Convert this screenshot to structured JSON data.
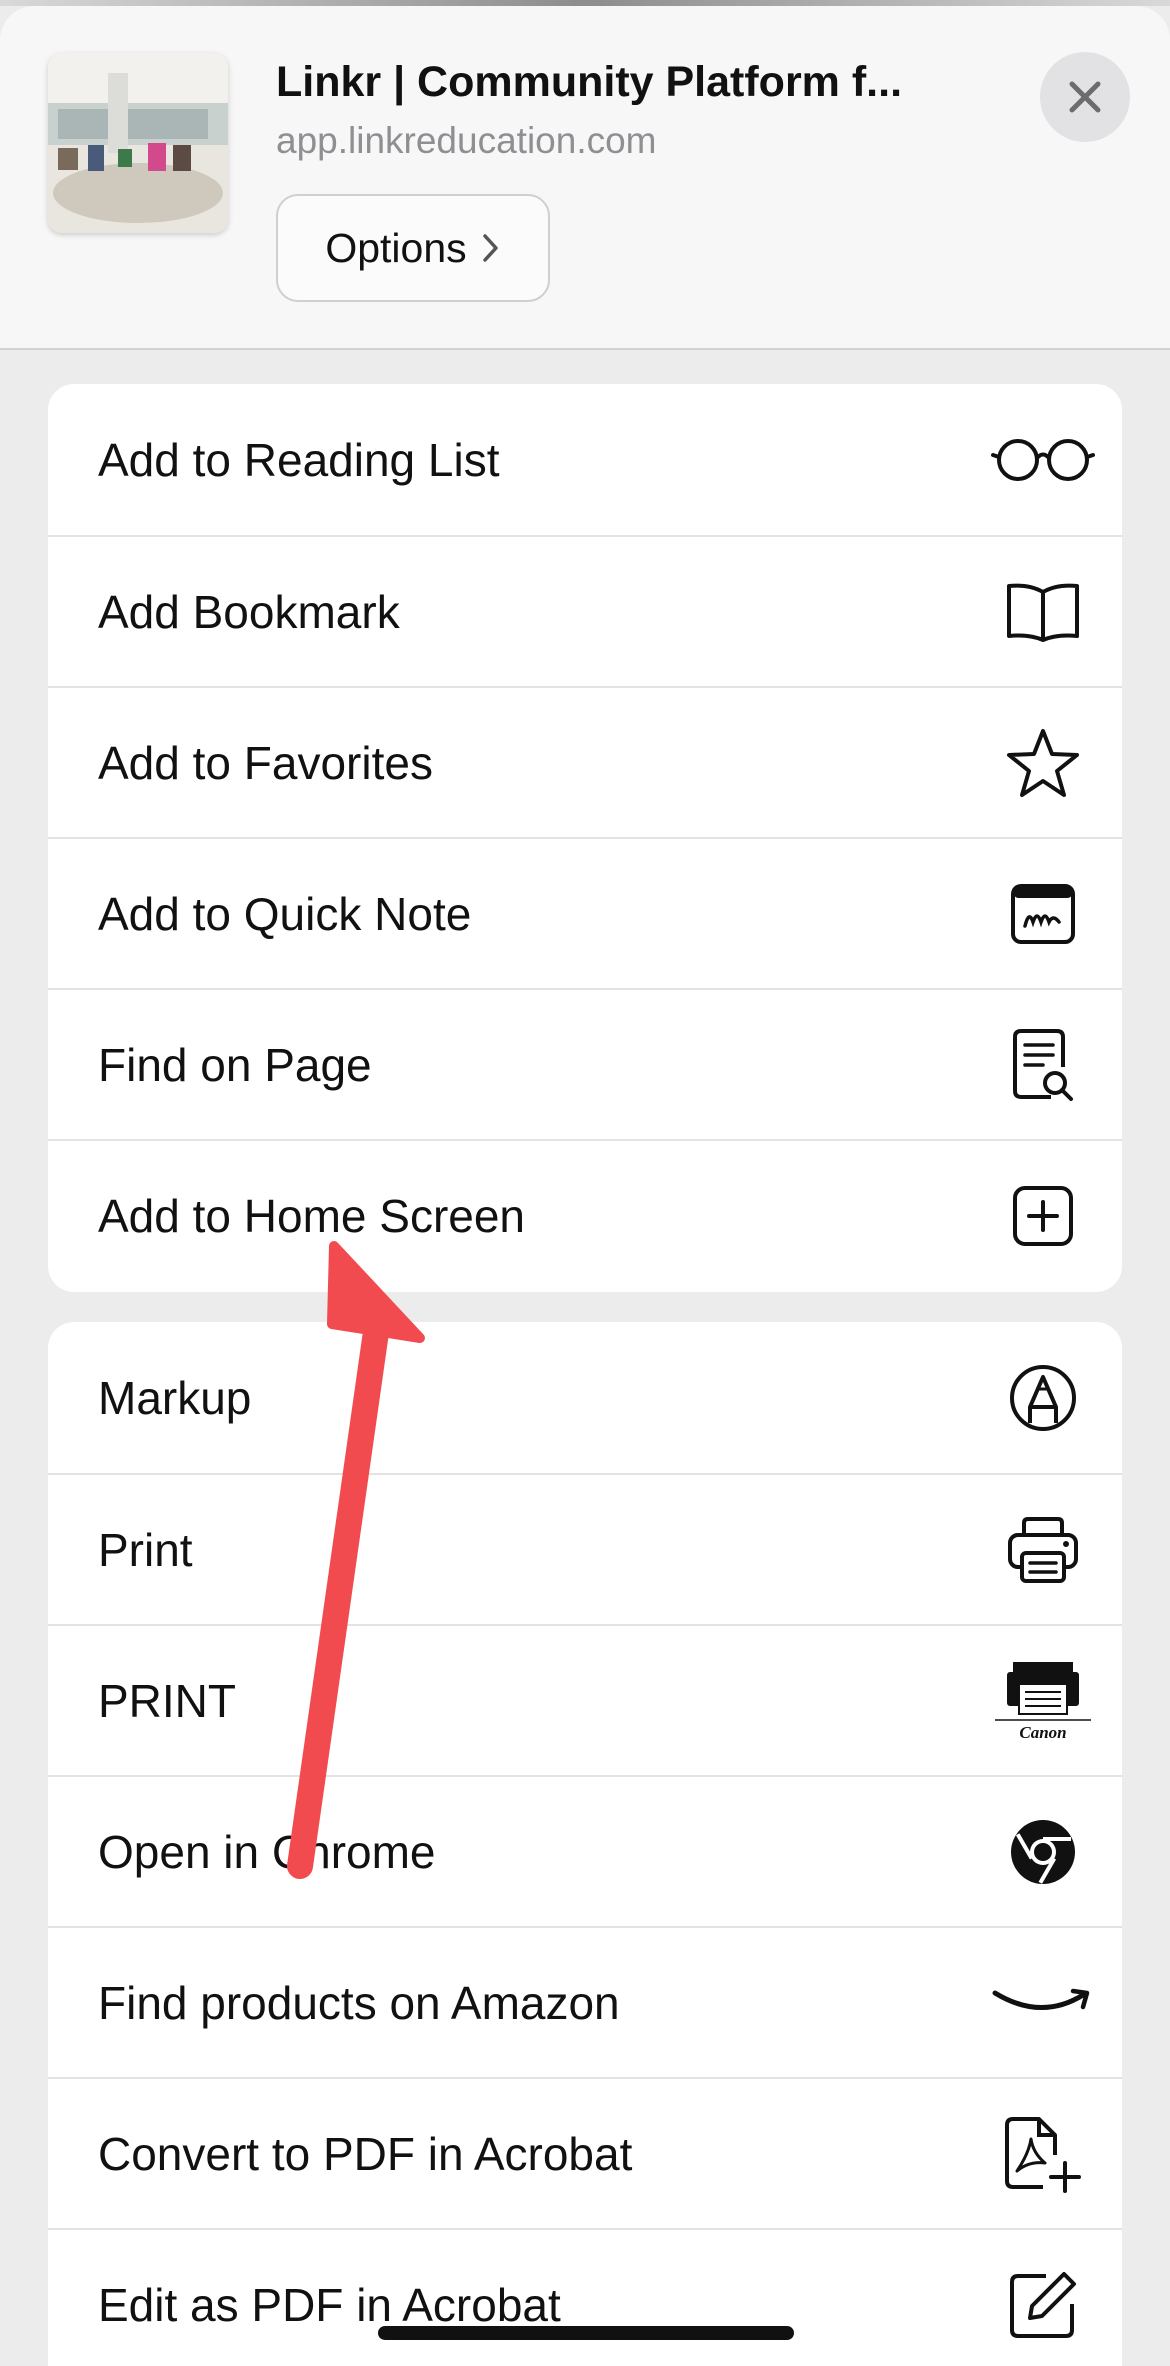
{
  "header": {
    "title": "Linkr | Community Platform f...",
    "url": "app.linkreducation.com",
    "options_label": "Options"
  },
  "actions_group_1": [
    {
      "label": "Add to Reading List",
      "icon": "glasses-icon"
    },
    {
      "label": "Add Bookmark",
      "icon": "book-icon"
    },
    {
      "label": "Add to Favorites",
      "icon": "star-icon"
    },
    {
      "label": "Add to Quick Note",
      "icon": "quick-note-icon"
    },
    {
      "label": "Find on Page",
      "icon": "find-document-icon"
    },
    {
      "label": "Add to Home Screen",
      "icon": "plus-square-icon"
    }
  ],
  "actions_group_2": [
    {
      "label": "Markup",
      "icon": "markup-pen-icon"
    },
    {
      "label": "Print",
      "icon": "printer-icon"
    },
    {
      "label": "PRINT",
      "icon": "canon-printer-icon",
      "icon_caption": "Canon"
    },
    {
      "label": "Open in Chrome",
      "icon": "chrome-icon"
    },
    {
      "label": "Find products on Amazon",
      "icon": "amazon-smile-icon"
    },
    {
      "label": "Convert to PDF in Acrobat",
      "icon": "acrobat-pdf-add-icon"
    },
    {
      "label": "Edit as PDF in Acrobat",
      "icon": "edit-square-icon"
    }
  ],
  "colors": {
    "annotation_arrow": "#f24b4f",
    "sheet_background": "#ececec",
    "secondary_text": "#8e8e93"
  }
}
